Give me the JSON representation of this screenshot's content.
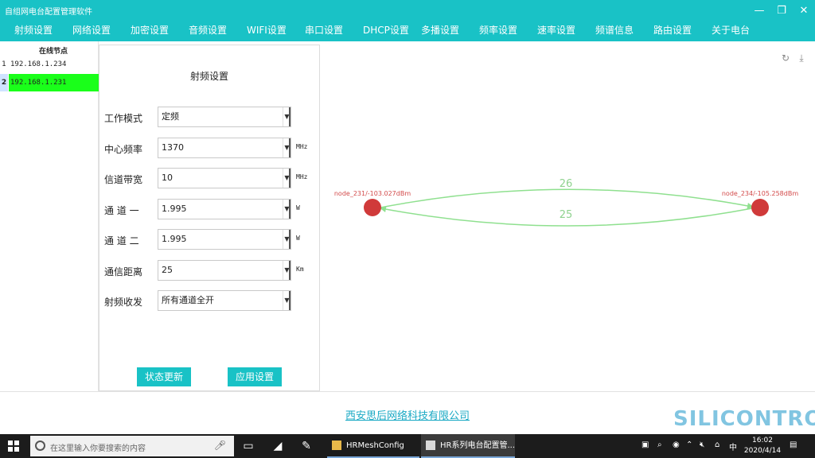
{
  "window": {
    "title": "自组网电台配置管理软件",
    "minimize_glyph": "—",
    "restore_glyph": "❐",
    "close_glyph": "✕"
  },
  "menu": [
    "射频设置",
    "网络设置",
    "加密设置",
    "音频设置",
    "WIFI设置",
    "串口设置",
    "DHCP设置",
    "多播设置",
    "频率设置",
    "速率设置",
    "频谱信息",
    "路由设置",
    "关于电台"
  ],
  "nodes": {
    "header": "在线节点",
    "items": [
      {
        "num": "1",
        "ip": "192.168.1.234"
      },
      {
        "num": "2",
        "ip": "192.168.1.231"
      }
    ]
  },
  "panel": {
    "title": "射频设置",
    "fields": [
      {
        "label": "工作模式",
        "value": "定频",
        "unit": ""
      },
      {
        "label": "中心频率",
        "value": "1370",
        "unit": "MHz"
      },
      {
        "label": "信道带宽",
        "value": "10",
        "unit": "MHz"
      },
      {
        "label": "通 道 一",
        "value": "1.995",
        "unit": "W"
      },
      {
        "label": "通 道 二",
        "value": "1.995",
        "unit": "W"
      },
      {
        "label": "通信距离",
        "value": "25",
        "unit": "Km"
      },
      {
        "label": "射频收发",
        "value": "所有通道全开",
        "unit": ""
      }
    ],
    "status_button": "状态更新",
    "apply_button": "应用设置"
  },
  "topology": {
    "node_a_label": "node_231/-103.027dBm",
    "node_b_label": "node_234/-105.258dBm",
    "link_top_value": "26",
    "link_bottom_value": "25",
    "node_color": "#d03a3a",
    "link_color": "#8fe08f",
    "refresh_icon": "refresh-icon",
    "download_icon": "download-icon"
  },
  "footer": {
    "company": "西安思后网络科技有限公司",
    "watermark": "SILICONTROL"
  },
  "taskbar": {
    "search_placeholder": "在这里输入你要搜索的内容",
    "apps": [
      "HRMeshConfig",
      "HR系列电台配置管..."
    ],
    "ime": "中",
    "time": "16:02",
    "date": "2020/4/14"
  },
  "colors": {
    "accent": "#19c2c6",
    "selected_row": "#1aff1a",
    "company_link": "#19a9c4"
  }
}
